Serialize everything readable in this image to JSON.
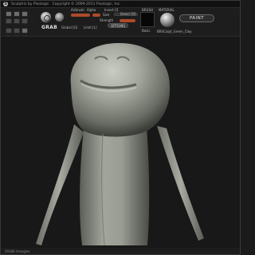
{
  "app": {
    "title": "Sculptris by Pixologic",
    "copyright": "Copyright © 2009-2011 Pixologic, Inc."
  },
  "toolbar": {
    "grab_label": "GRAB",
    "airbrush": "Airbrush",
    "alpha": "Alpha",
    "invert_label": "Invert [I]",
    "size_label": "Size",
    "detail_label": "Detail [D]",
    "strength_label": "Strength",
    "global_label": "Global [G]",
    "limit_label": "Limit [L]",
    "options_label": "OPTIONS",
    "brush_label": "BRUSH",
    "brush_name": "Basic",
    "material_label": "MATERIAL",
    "material_name": "BRSCulpt_Green_Clay",
    "paint_label": "PAINT"
  },
  "status": {
    "triangles": "29186 triangles"
  },
  "colors": {
    "accent": "#ae4a28",
    "background": "#1b1b1b",
    "clay": "#9b9e95"
  }
}
